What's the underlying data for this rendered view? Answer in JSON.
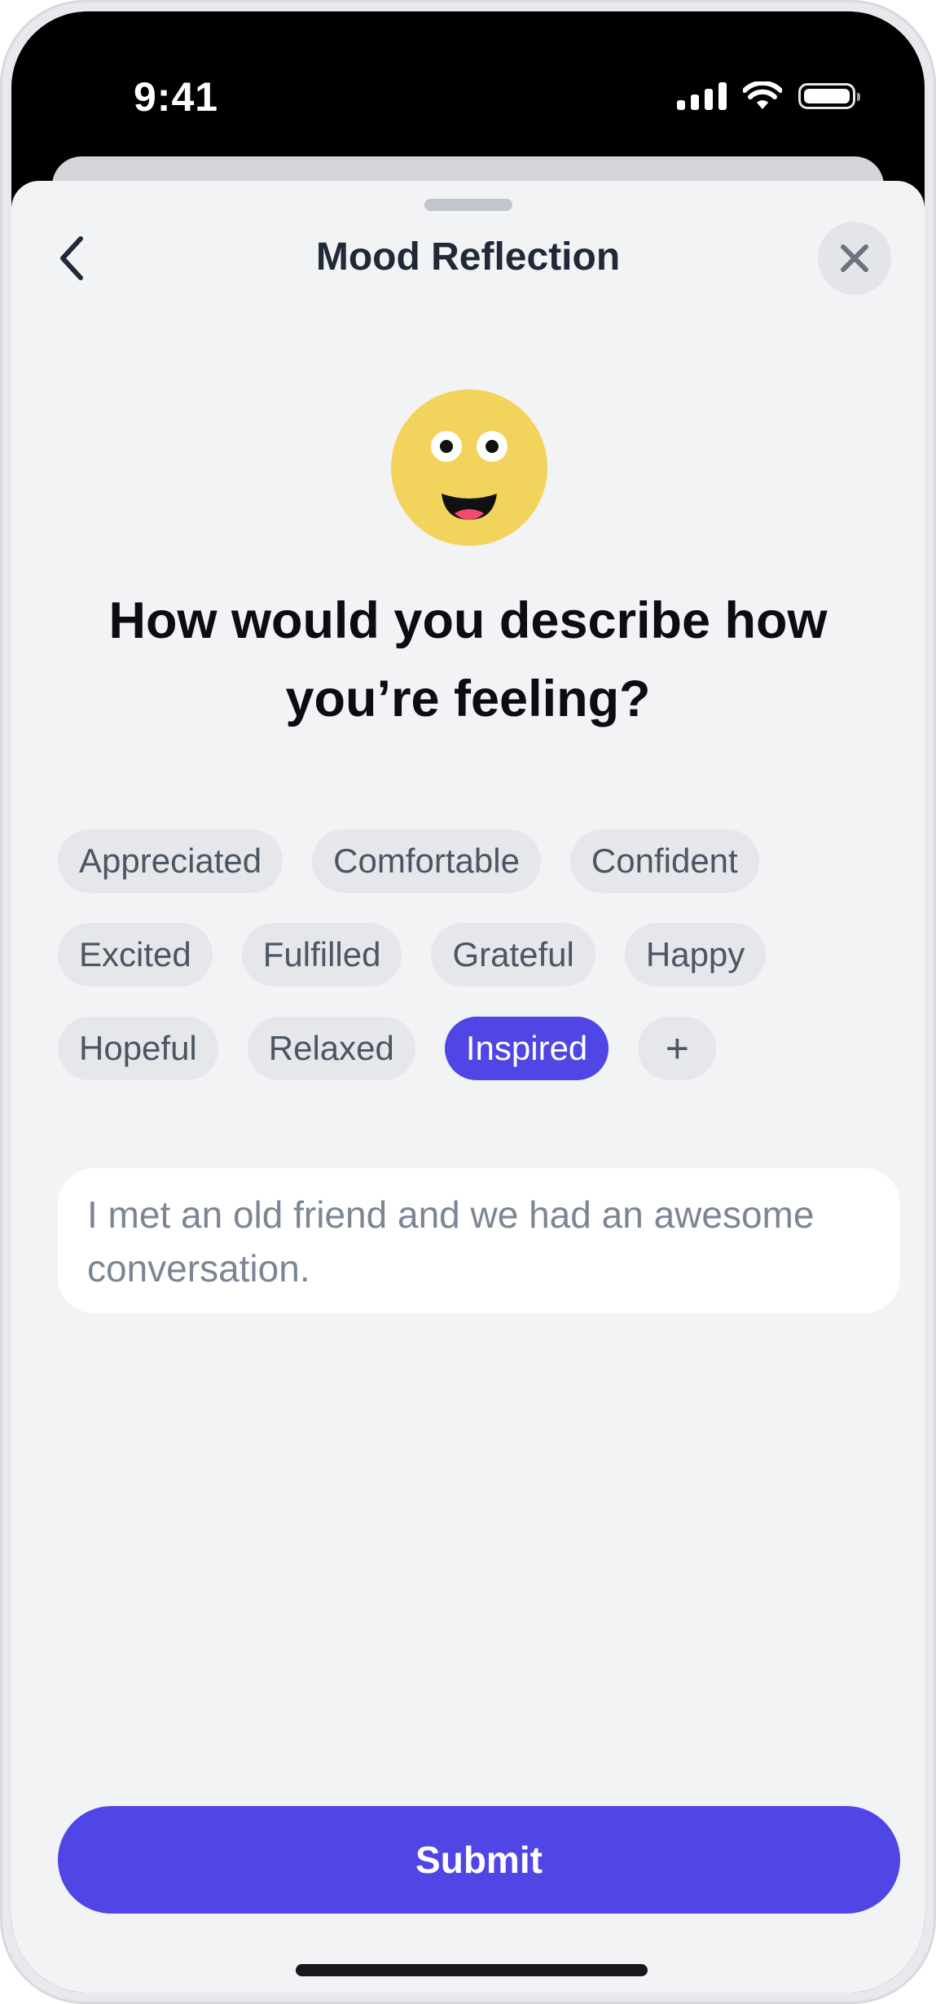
{
  "status_bar": {
    "time": "9:41",
    "icons": [
      "cellular-signal-icon",
      "wifi-icon",
      "battery-icon"
    ]
  },
  "header": {
    "title": "Mood Reflection",
    "back_icon": "chevron-left-icon",
    "close_icon": "close-icon"
  },
  "mood": {
    "emoji_icon": "smiling-face-icon",
    "question": "How would you describe how you’re feeling?"
  },
  "feelings": {
    "rows": [
      [
        {
          "label": "Appreciated",
          "selected": false
        },
        {
          "label": "Comfortable",
          "selected": false
        },
        {
          "label": "Confident",
          "selected": false
        }
      ],
      [
        {
          "label": "Excited",
          "selected": false
        },
        {
          "label": "Fulfilled",
          "selected": false
        },
        {
          "label": "Grateful",
          "selected": false
        },
        {
          "label": "Happy",
          "selected": false
        }
      ],
      [
        {
          "label": "Hopeful",
          "selected": false
        },
        {
          "label": "Relaxed",
          "selected": false
        },
        {
          "label": "Inspired",
          "selected": true
        },
        {
          "label": "+",
          "selected": false
        }
      ]
    ]
  },
  "note": {
    "value": "I met an old friend and we had an awesome conversation."
  },
  "actions": {
    "submit_label": "Submit"
  },
  "colors": {
    "accent": "#4f46e5",
    "chip_bg": "#e5e7eb",
    "sheet_bg": "#f2f3f5",
    "emoji_face": "#f2d45c"
  }
}
